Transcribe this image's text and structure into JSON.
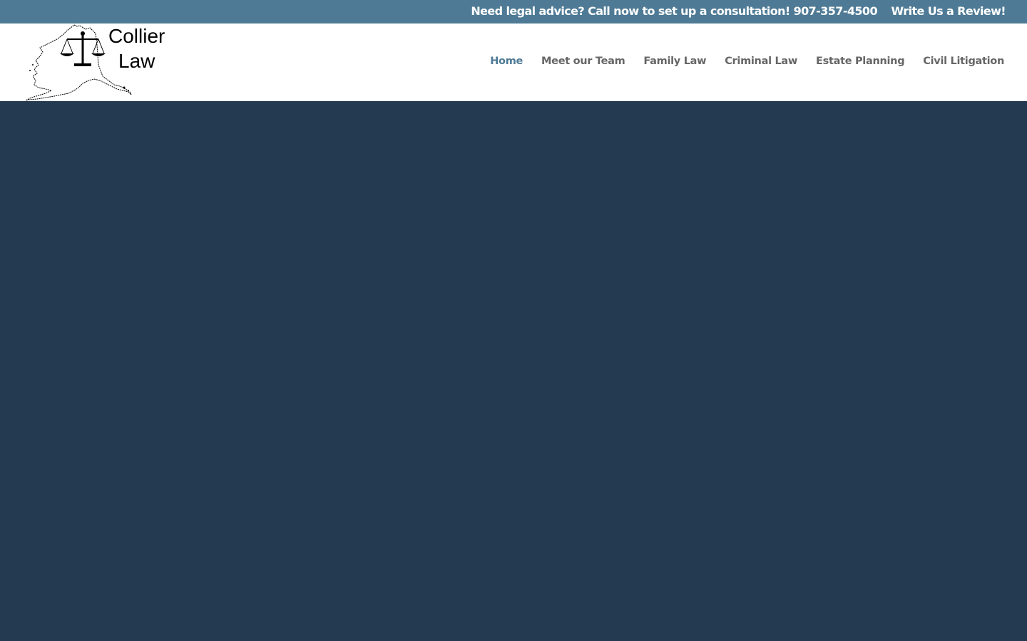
{
  "topbar": {
    "phone_text": "Need legal advice? Call now to set up a consultation! 907-357-4500",
    "review_link": "Write Us a Review!"
  },
  "logo": {
    "line1": "Collier",
    "line2": "Law",
    "icon": "alaska-map-scales-of-justice-icon"
  },
  "nav": {
    "items": [
      {
        "label": "Home",
        "active": true
      },
      {
        "label": "Meet our Team",
        "active": false
      },
      {
        "label": "Family Law",
        "active": false
      },
      {
        "label": "Criminal Law",
        "active": false
      },
      {
        "label": "Estate Planning",
        "active": false
      },
      {
        "label": "Civil Litigation",
        "active": false
      }
    ]
  },
  "colors": {
    "topbar_bg": "#4e7a95",
    "nav_active": "#4e7a95",
    "nav_text": "#666666",
    "hero_bg": "#243a50"
  }
}
